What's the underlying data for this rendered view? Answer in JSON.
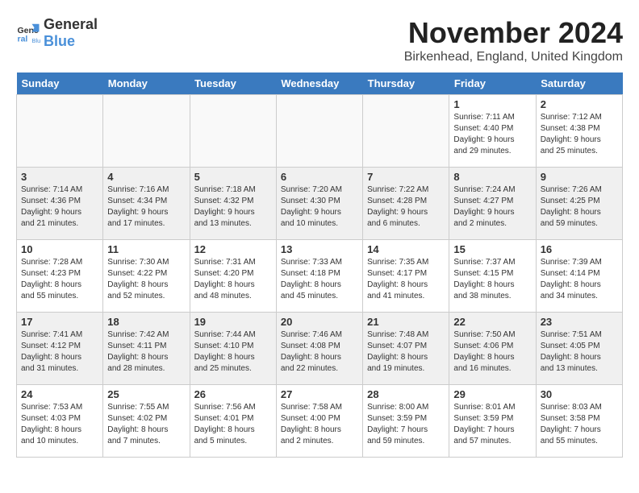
{
  "header": {
    "logo_general": "General",
    "logo_blue": "Blue",
    "month": "November 2024",
    "location": "Birkenhead, England, United Kingdom"
  },
  "weekdays": [
    "Sunday",
    "Monday",
    "Tuesday",
    "Wednesday",
    "Thursday",
    "Friday",
    "Saturday"
  ],
  "weeks": [
    [
      {
        "day": "",
        "info": ""
      },
      {
        "day": "",
        "info": ""
      },
      {
        "day": "",
        "info": ""
      },
      {
        "day": "",
        "info": ""
      },
      {
        "day": "",
        "info": ""
      },
      {
        "day": "1",
        "info": "Sunrise: 7:11 AM\nSunset: 4:40 PM\nDaylight: 9 hours\nand 29 minutes."
      },
      {
        "day": "2",
        "info": "Sunrise: 7:12 AM\nSunset: 4:38 PM\nDaylight: 9 hours\nand 25 minutes."
      }
    ],
    [
      {
        "day": "3",
        "info": "Sunrise: 7:14 AM\nSunset: 4:36 PM\nDaylight: 9 hours\nand 21 minutes."
      },
      {
        "day": "4",
        "info": "Sunrise: 7:16 AM\nSunset: 4:34 PM\nDaylight: 9 hours\nand 17 minutes."
      },
      {
        "day": "5",
        "info": "Sunrise: 7:18 AM\nSunset: 4:32 PM\nDaylight: 9 hours\nand 13 minutes."
      },
      {
        "day": "6",
        "info": "Sunrise: 7:20 AM\nSunset: 4:30 PM\nDaylight: 9 hours\nand 10 minutes."
      },
      {
        "day": "7",
        "info": "Sunrise: 7:22 AM\nSunset: 4:28 PM\nDaylight: 9 hours\nand 6 minutes."
      },
      {
        "day": "8",
        "info": "Sunrise: 7:24 AM\nSunset: 4:27 PM\nDaylight: 9 hours\nand 2 minutes."
      },
      {
        "day": "9",
        "info": "Sunrise: 7:26 AM\nSunset: 4:25 PM\nDaylight: 8 hours\nand 59 minutes."
      }
    ],
    [
      {
        "day": "10",
        "info": "Sunrise: 7:28 AM\nSunset: 4:23 PM\nDaylight: 8 hours\nand 55 minutes."
      },
      {
        "day": "11",
        "info": "Sunrise: 7:30 AM\nSunset: 4:22 PM\nDaylight: 8 hours\nand 52 minutes."
      },
      {
        "day": "12",
        "info": "Sunrise: 7:31 AM\nSunset: 4:20 PM\nDaylight: 8 hours\nand 48 minutes."
      },
      {
        "day": "13",
        "info": "Sunrise: 7:33 AM\nSunset: 4:18 PM\nDaylight: 8 hours\nand 45 minutes."
      },
      {
        "day": "14",
        "info": "Sunrise: 7:35 AM\nSunset: 4:17 PM\nDaylight: 8 hours\nand 41 minutes."
      },
      {
        "day": "15",
        "info": "Sunrise: 7:37 AM\nSunset: 4:15 PM\nDaylight: 8 hours\nand 38 minutes."
      },
      {
        "day": "16",
        "info": "Sunrise: 7:39 AM\nSunset: 4:14 PM\nDaylight: 8 hours\nand 34 minutes."
      }
    ],
    [
      {
        "day": "17",
        "info": "Sunrise: 7:41 AM\nSunset: 4:12 PM\nDaylight: 8 hours\nand 31 minutes."
      },
      {
        "day": "18",
        "info": "Sunrise: 7:42 AM\nSunset: 4:11 PM\nDaylight: 8 hours\nand 28 minutes."
      },
      {
        "day": "19",
        "info": "Sunrise: 7:44 AM\nSunset: 4:10 PM\nDaylight: 8 hours\nand 25 minutes."
      },
      {
        "day": "20",
        "info": "Sunrise: 7:46 AM\nSunset: 4:08 PM\nDaylight: 8 hours\nand 22 minutes."
      },
      {
        "day": "21",
        "info": "Sunrise: 7:48 AM\nSunset: 4:07 PM\nDaylight: 8 hours\nand 19 minutes."
      },
      {
        "day": "22",
        "info": "Sunrise: 7:50 AM\nSunset: 4:06 PM\nDaylight: 8 hours\nand 16 minutes."
      },
      {
        "day": "23",
        "info": "Sunrise: 7:51 AM\nSunset: 4:05 PM\nDaylight: 8 hours\nand 13 minutes."
      }
    ],
    [
      {
        "day": "24",
        "info": "Sunrise: 7:53 AM\nSunset: 4:03 PM\nDaylight: 8 hours\nand 10 minutes."
      },
      {
        "day": "25",
        "info": "Sunrise: 7:55 AM\nSunset: 4:02 PM\nDaylight: 8 hours\nand 7 minutes."
      },
      {
        "day": "26",
        "info": "Sunrise: 7:56 AM\nSunset: 4:01 PM\nDaylight: 8 hours\nand 5 minutes."
      },
      {
        "day": "27",
        "info": "Sunrise: 7:58 AM\nSunset: 4:00 PM\nDaylight: 8 hours\nand 2 minutes."
      },
      {
        "day": "28",
        "info": "Sunrise: 8:00 AM\nSunset: 3:59 PM\nDaylight: 7 hours\nand 59 minutes."
      },
      {
        "day": "29",
        "info": "Sunrise: 8:01 AM\nSunset: 3:59 PM\nDaylight: 7 hours\nand 57 minutes."
      },
      {
        "day": "30",
        "info": "Sunrise: 8:03 AM\nSunset: 3:58 PM\nDaylight: 7 hours\nand 55 minutes."
      }
    ]
  ]
}
